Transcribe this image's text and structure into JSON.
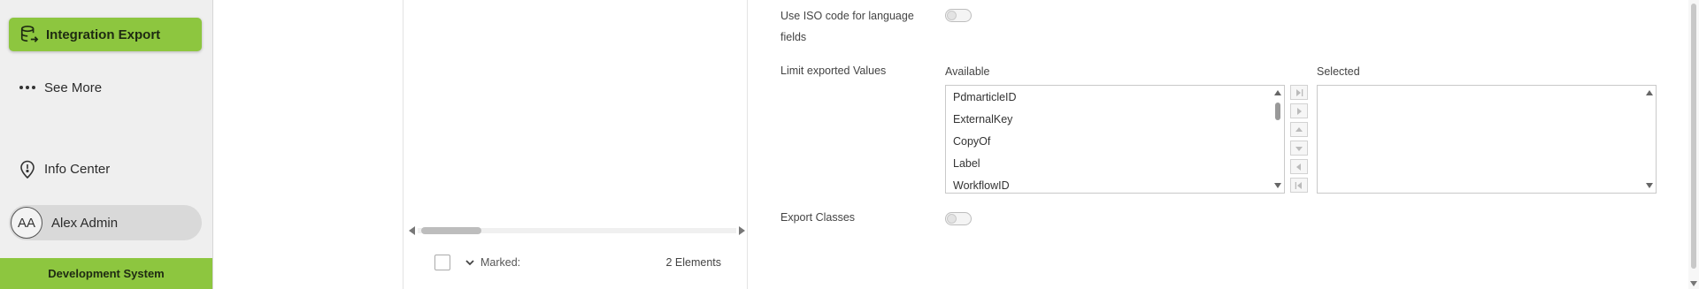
{
  "sidebar": {
    "active_item": {
      "label": "Integration Export",
      "icon": "database-export-icon"
    },
    "items": [
      {
        "label": "See More",
        "icon": "more-dots-icon"
      },
      {
        "label": "Info Center",
        "icon": "info-pin-icon"
      }
    ],
    "user": {
      "initials": "AA",
      "name": "Alex Admin"
    },
    "environment": "Development System"
  },
  "middle_panel": {
    "footer": {
      "marked_label": "Marked:",
      "count_text": "2 Elements"
    }
  },
  "form": {
    "iso_code": {
      "label": "Use ISO code for language fields",
      "enabled": false
    },
    "limit_values": {
      "label": "Limit exported Values",
      "available_header": "Available",
      "selected_header": "Selected",
      "available_items": [
        "PdmarticleID",
        "ExternalKey",
        "CopyOf",
        "Label",
        "WorkflowID"
      ],
      "selected_items": []
    },
    "export_classes": {
      "label": "Export Classes",
      "enabled": false
    }
  },
  "colors": {
    "accent": "#8dc63f",
    "sidebar_bg": "#efefef"
  }
}
